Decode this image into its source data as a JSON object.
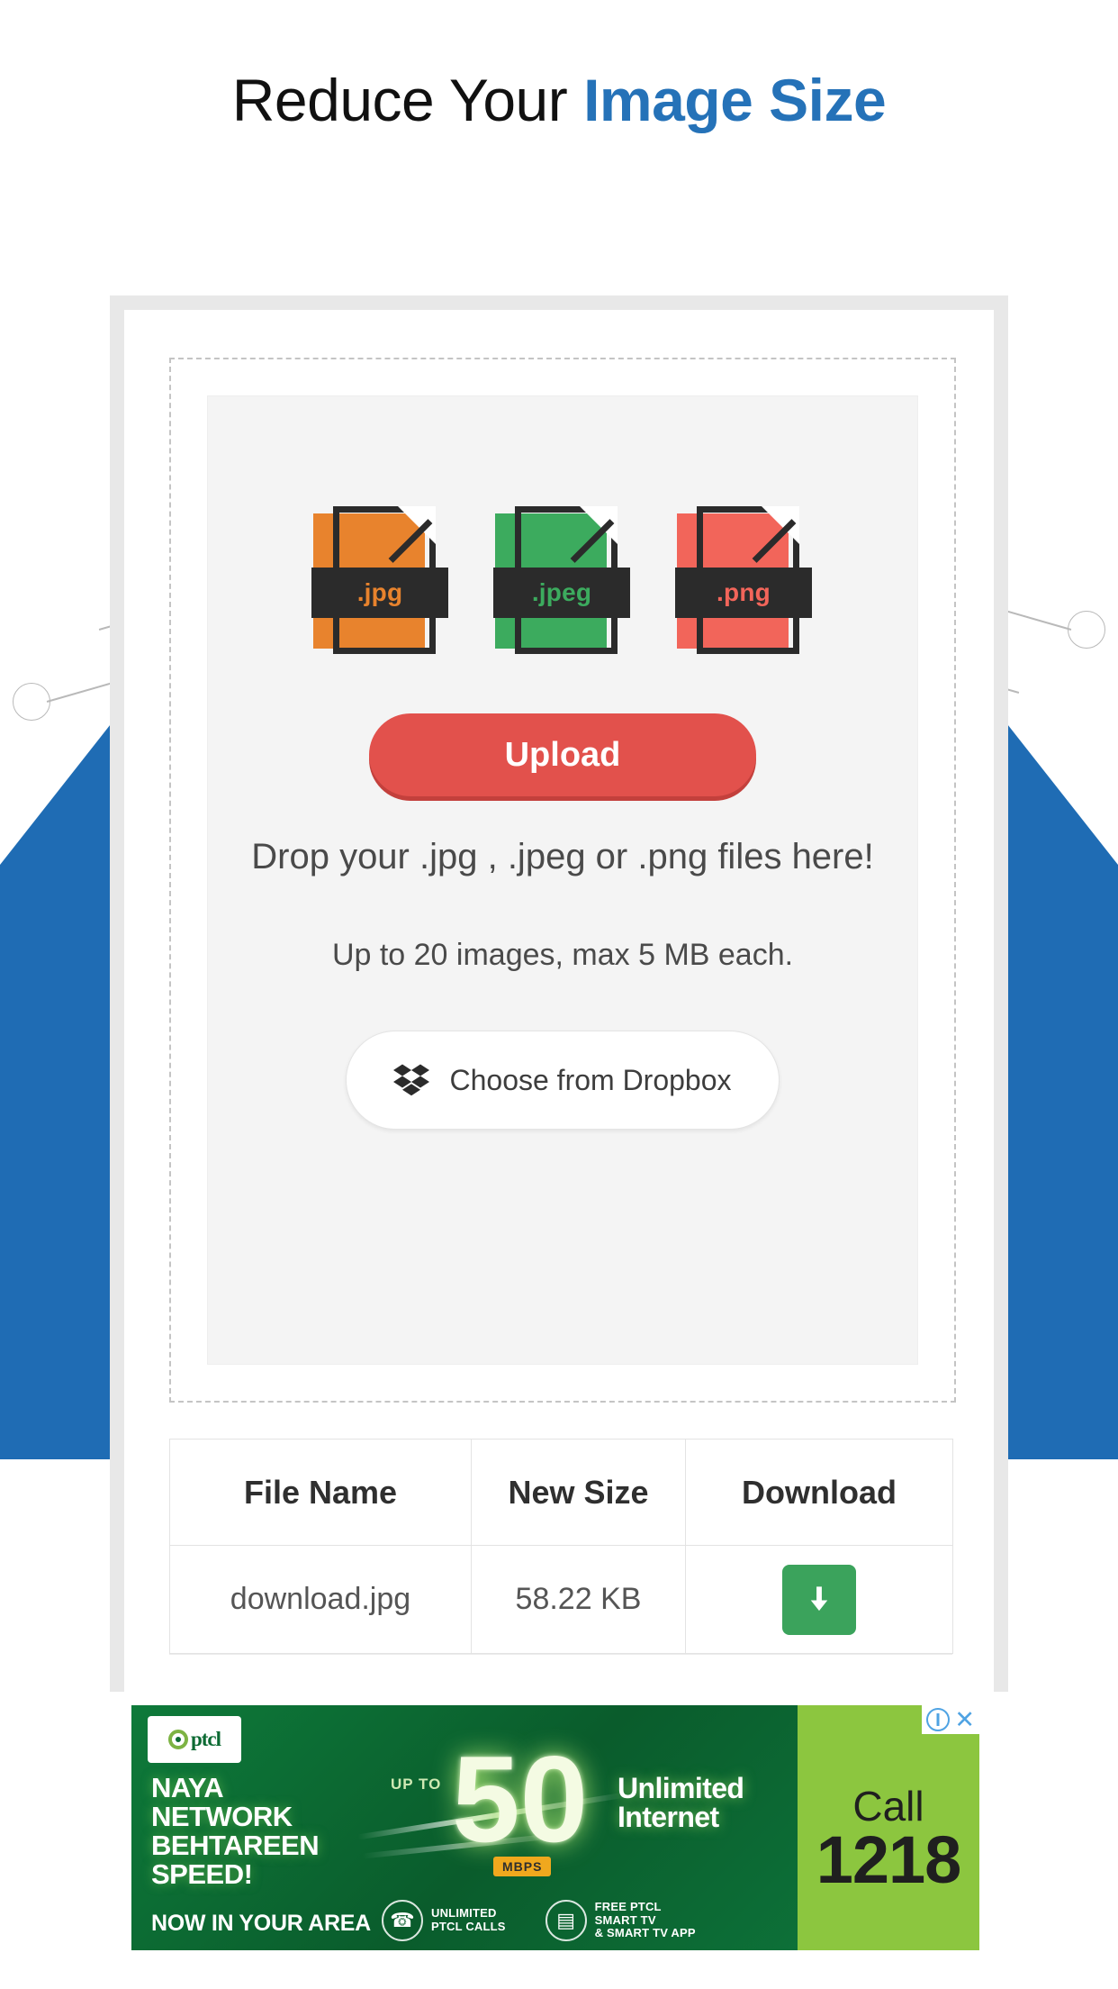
{
  "page": {
    "title_plain": "Reduce Your ",
    "title_accent": "Image Size",
    "accent_color": "#2572b8",
    "background_shape_color": "#1f6cb4"
  },
  "dropzone": {
    "filetypes": [
      {
        "label": ".jpg",
        "color": "#e8832d",
        "icon": "jpg-file-icon"
      },
      {
        "label": ".jpeg",
        "color": "#3cab5e",
        "icon": "jpeg-file-icon"
      },
      {
        "label": ".png",
        "color": "#f2655a",
        "icon": "png-file-icon"
      }
    ],
    "upload_button": "Upload",
    "upload_button_color": "#e2514c",
    "drop_text": "Drop your .jpg , .jpeg or .png files here!",
    "limit_text": "Up to 20 images, max 5 MB each.",
    "dropbox_button": "Choose from Dropbox",
    "dropbox_icon": "dropbox-icon"
  },
  "results": {
    "headers": [
      "File Name",
      "New Size",
      "Download"
    ],
    "rows": [
      {
        "file_name": "download.jpg",
        "new_size": "58.22 KB",
        "download_icon": "download-arrow-icon",
        "download_color": "#3ba35c"
      }
    ]
  },
  "ad": {
    "brand": "ptcl",
    "headline": "NAYA\nNETWORK\nBEHTAREEN\nSPEED!",
    "subline": "NOW IN YOUR AREA",
    "upto": "UP TO",
    "speed": "50",
    "speed_unit": "MBPS",
    "offer_line1": "Unlimited",
    "offer_line2": "Internet",
    "features": [
      {
        "icon": "phone-icon",
        "text": "UNLIMITED\nPTCL CALLS"
      },
      {
        "icon": "smart-tv-icon",
        "text": "FREE PTCL\nSMART TV\n& SMART TV APP"
      }
    ],
    "call_label": "Call",
    "call_number": "1218",
    "controls": {
      "info_icon": "ad-info-icon",
      "close_icon": "ad-close-icon"
    }
  }
}
